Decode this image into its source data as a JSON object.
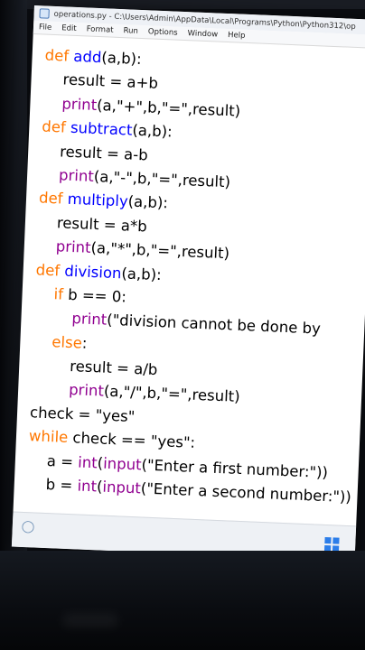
{
  "window": {
    "title": "operations.py - C:\\Users\\Admin\\AppData\\Local\\Programs\\Python\\Python312\\op"
  },
  "menu": [
    "File",
    "Edit",
    "Format",
    "Run",
    "Options",
    "Window",
    "Help"
  ],
  "code_lines": [
    [
      {
        "t": "def ",
        "c": "kw"
      },
      {
        "t": "add",
        "c": "fn"
      },
      {
        "t": "(a,b):",
        "c": "txt"
      }
    ],
    [
      {
        "t": "    result = a+b",
        "c": "txt"
      }
    ],
    [
      {
        "t": "    ",
        "c": "txt"
      },
      {
        "t": "print",
        "c": "bi"
      },
      {
        "t": "(a,\"+\",b,\"=\",result)",
        "c": "txt"
      }
    ],
    [
      {
        "t": "def ",
        "c": "kw"
      },
      {
        "t": "subtract",
        "c": "fn"
      },
      {
        "t": "(a,b):",
        "c": "txt"
      }
    ],
    [
      {
        "t": "    result = a-b",
        "c": "txt"
      }
    ],
    [
      {
        "t": "    ",
        "c": "txt"
      },
      {
        "t": "print",
        "c": "bi"
      },
      {
        "t": "(a,\"-\",b,\"=\",result)",
        "c": "txt"
      }
    ],
    [
      {
        "t": "def ",
        "c": "kw"
      },
      {
        "t": "multiply",
        "c": "fn"
      },
      {
        "t": "(a,b):",
        "c": "txt"
      }
    ],
    [
      {
        "t": "    result = a*b",
        "c": "txt"
      }
    ],
    [
      {
        "t": "    ",
        "c": "txt"
      },
      {
        "t": "print",
        "c": "bi"
      },
      {
        "t": "(a,\"*\",b,\"=\",result)",
        "c": "txt"
      }
    ],
    [
      {
        "t": "def ",
        "c": "kw"
      },
      {
        "t": "division",
        "c": "fn"
      },
      {
        "t": "(a,b):",
        "c": "txt"
      }
    ],
    [
      {
        "t": "    ",
        "c": "txt"
      },
      {
        "t": "if",
        "c": "kw"
      },
      {
        "t": " b == 0:",
        "c": "txt"
      }
    ],
    [
      {
        "t": "        ",
        "c": "txt"
      },
      {
        "t": "print",
        "c": "bi"
      },
      {
        "t": "(\"division cannot be done by",
        "c": "txt"
      }
    ],
    [
      {
        "t": "    ",
        "c": "txt"
      },
      {
        "t": "else",
        "c": "kw"
      },
      {
        "t": ":",
        "c": "txt"
      }
    ],
    [
      {
        "t": "        result = a/b",
        "c": "txt"
      }
    ],
    [
      {
        "t": "        ",
        "c": "txt"
      },
      {
        "t": "print",
        "c": "bi"
      },
      {
        "t": "(a,\"/\",b,\"=\",result)",
        "c": "txt"
      }
    ],
    [
      {
        "t": "check = \"yes\"",
        "c": "txt"
      }
    ],
    [
      {
        "t": "while",
        "c": "kw"
      },
      {
        "t": " check == \"yes\":",
        "c": "txt"
      }
    ],
    [
      {
        "t": "    a = ",
        "c": "txt"
      },
      {
        "t": "int",
        "c": "bi"
      },
      {
        "t": "(",
        "c": "txt"
      },
      {
        "t": "input",
        "c": "bi"
      },
      {
        "t": "(\"Enter a first number:\"))",
        "c": "txt"
      }
    ],
    [
      {
        "t": "    b = ",
        "c": "txt"
      },
      {
        "t": "int",
        "c": "bi"
      },
      {
        "t": "(",
        "c": "txt"
      },
      {
        "t": "input",
        "c": "bi"
      },
      {
        "t": "(\"Enter a second number:\"))",
        "c": "txt"
      }
    ]
  ]
}
